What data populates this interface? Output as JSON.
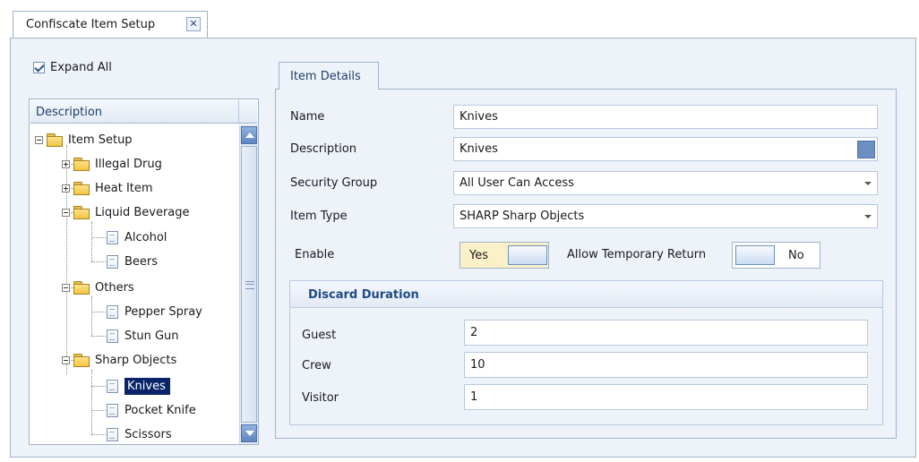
{
  "doc_tab": {
    "title": "Confiscate Item Setup",
    "close_glyph": "✕"
  },
  "expand_all": {
    "label": "Expand All",
    "checked": true
  },
  "tree": {
    "header": "Description",
    "items": [
      {
        "label": "Item Setup"
      },
      {
        "label": "Illegal Drug"
      },
      {
        "label": "Heat Item"
      },
      {
        "label": "Liquid Beverage"
      },
      {
        "label": "Alcohol"
      },
      {
        "label": "Beers"
      },
      {
        "label": "Others"
      },
      {
        "label": "Pepper Spray"
      },
      {
        "label": "Stun Gun"
      },
      {
        "label": "Sharp Objects"
      },
      {
        "label": "Knives"
      },
      {
        "label": "Pocket Knife"
      },
      {
        "label": "Scissors"
      }
    ],
    "selected": "Knives"
  },
  "details": {
    "tab_label": "Item Details",
    "name_label": "Name",
    "name_value": "Knives",
    "description_label": "Description",
    "description_value": "Knives",
    "security_group_label": "Security Group",
    "security_group_value": "All User Can Access",
    "item_type_label": "Item Type",
    "item_type_value": "SHARP Sharp Objects",
    "enable_label": "Enable",
    "enable_value": "Yes",
    "temp_return_label": "Allow Temporary Return",
    "temp_return_value": "No"
  },
  "discard": {
    "header": "Discard Duration",
    "guest_label": "Guest",
    "guest_value": "2",
    "crew_label": "Crew",
    "crew_value": "10",
    "visitor_label": "Visitor",
    "visitor_value": "1"
  },
  "colors": {
    "panel_bg": "#eef3fa",
    "border": "#9fb3cc",
    "selection": "#0a246a",
    "header_text": "#1f4a86",
    "enable_on_bg": "#fbf0c8"
  }
}
